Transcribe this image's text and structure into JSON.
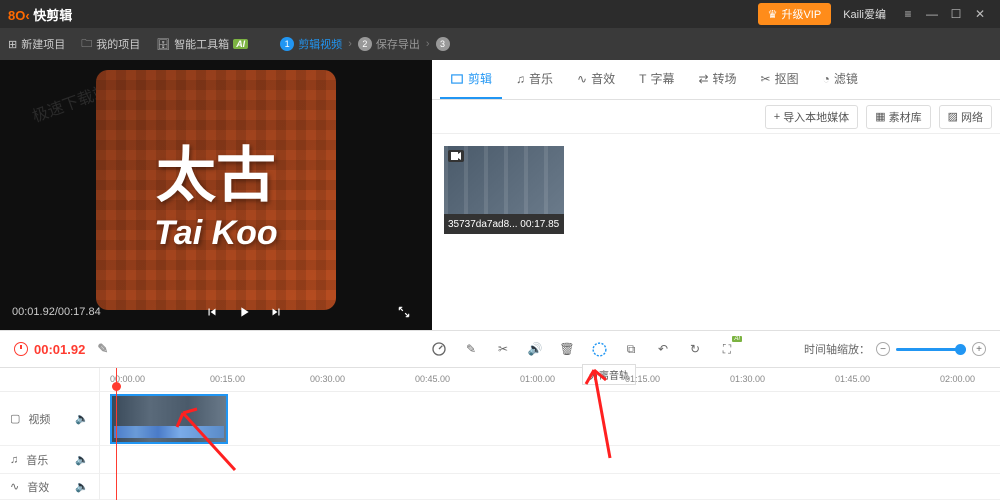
{
  "titlebar": {
    "app_name": "快剪辑",
    "vip_label": "升级VIP",
    "user_name": "Kaili爱编"
  },
  "menubar": {
    "new_project": "新建项目",
    "my_projects": "我的项目",
    "smart_toolbox": "智能工具箱",
    "steps": [
      {
        "num": "1",
        "label": "剪辑视频"
      },
      {
        "num": "2",
        "label": "保存导出"
      },
      {
        "num": "3",
        "label": ""
      }
    ]
  },
  "preview": {
    "text_cn": "太古",
    "text_en": "Tai Koo",
    "time": "00:01.92/00:17.84",
    "watermark": "极速下载站"
  },
  "media_tabs": [
    {
      "label": "剪辑"
    },
    {
      "label": "音乐"
    },
    {
      "label": "音效"
    },
    {
      "label": "字幕"
    },
    {
      "label": "转场"
    },
    {
      "label": "抠图"
    },
    {
      "label": "滤镜"
    }
  ],
  "media_tools": {
    "import": "导入本地媒体",
    "library": "素材库",
    "network": "网络"
  },
  "clip": {
    "name": "35737da7ad8...",
    "duration": "00:17.85"
  },
  "tl_toolbar": {
    "current_time": "00:01.92",
    "tooltip": "分离音轨",
    "zoom_label": "时间轴缩放："
  },
  "ruler_ticks": [
    {
      "pos": 10,
      "label": "00:00.00"
    },
    {
      "pos": 110,
      "label": "00:15.00"
    },
    {
      "pos": 210,
      "label": "00:30.00"
    },
    {
      "pos": 315,
      "label": "00:45.00"
    },
    {
      "pos": 420,
      "label": "01:00.00"
    },
    {
      "pos": 525,
      "label": "01:15.00"
    },
    {
      "pos": 630,
      "label": "01:30.00"
    },
    {
      "pos": 735,
      "label": "01:45.00"
    },
    {
      "pos": 840,
      "label": "02:00.00"
    }
  ],
  "tracks": {
    "video": "视频",
    "music": "音乐",
    "sfx": "音效"
  }
}
